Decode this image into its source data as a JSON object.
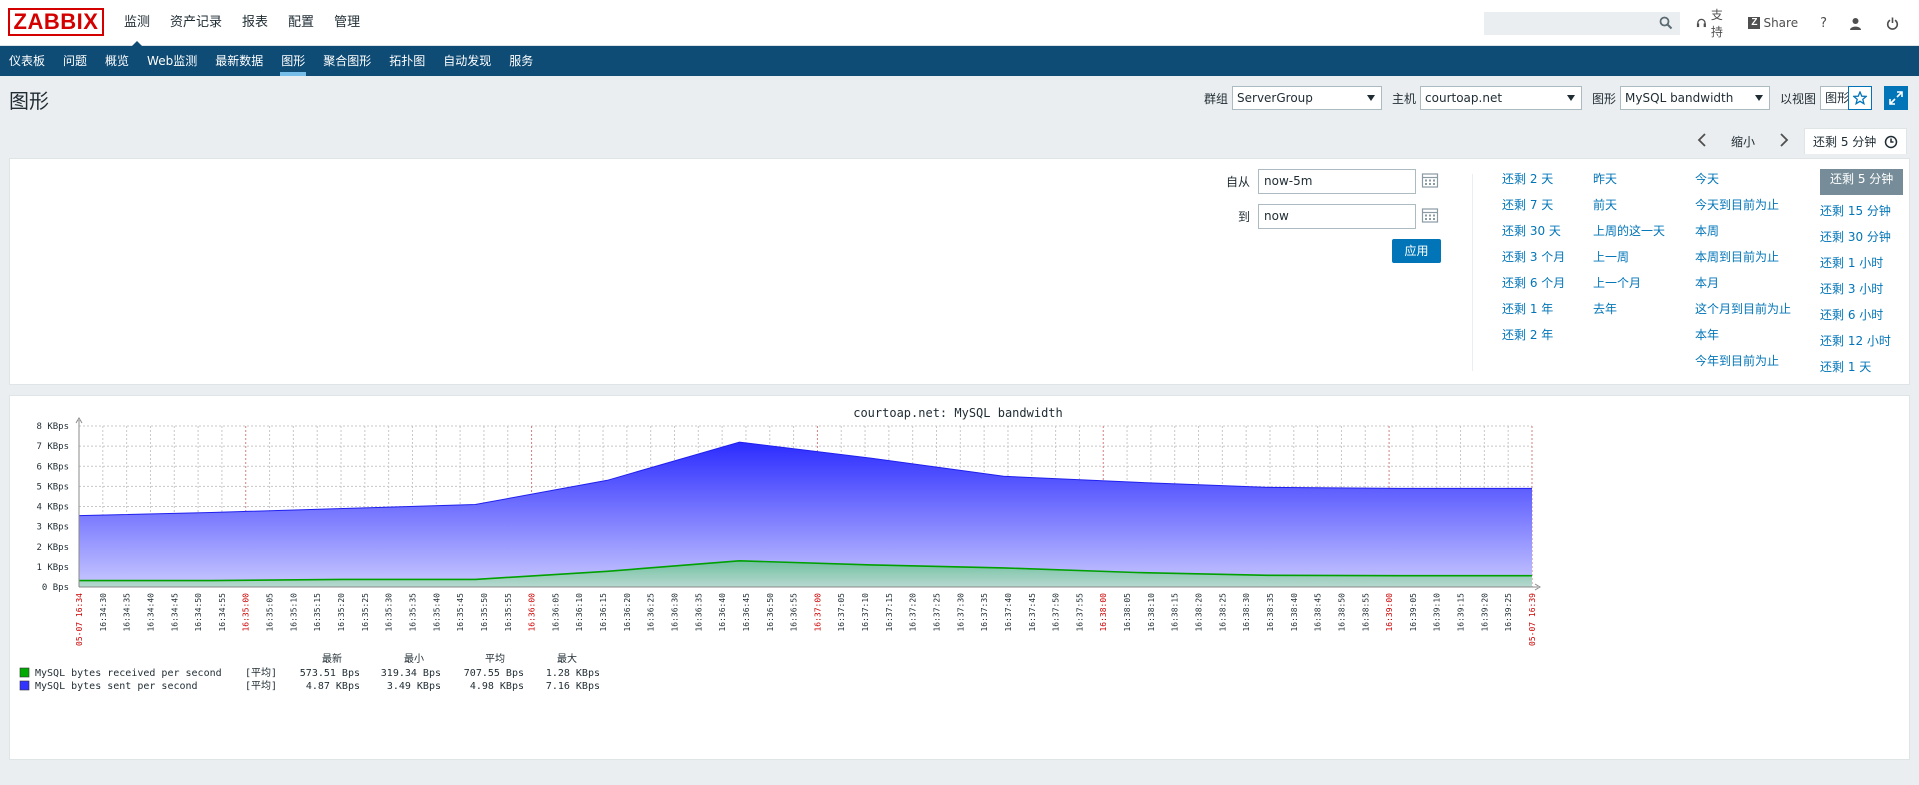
{
  "brand": "ZABBIX",
  "top_menu": [
    "监测",
    "资产记录",
    "报表",
    "配置",
    "管理"
  ],
  "top_tools": {
    "support": "支持",
    "share": "Share",
    "help": "?"
  },
  "sub_menu": [
    "仪表板",
    "问题",
    "概览",
    "Web监测",
    "最新数据",
    "图形",
    "聚合图形",
    "拓扑图",
    "自动发现",
    "服务"
  ],
  "page": {
    "title": "图形"
  },
  "filters": {
    "group_label": "群组",
    "group_value": "ServerGroup",
    "host_label": "主机",
    "host_value": "courtoap.net",
    "graph_label": "图形",
    "graph_value": "MySQL bandwidth",
    "view_label": "以视图",
    "view_value": "图形"
  },
  "timebar": {
    "zoom_out": "缩小",
    "current": "还剩 5 分钟"
  },
  "time_filter": {
    "from_label": "自从",
    "from_value": "now-5m",
    "to_label": "到",
    "to_value": "now",
    "apply": "应用",
    "col1": [
      "还剩 2 天",
      "还剩 7 天",
      "还剩 30 天",
      "还剩 3 个月",
      "还剩 6 个月",
      "还剩 1 年",
      "还剩 2 年"
    ],
    "col2": [
      "昨天",
      "前天",
      "上周的这一天",
      "上一周",
      "上一个月",
      "去年"
    ],
    "col3": [
      "今天",
      "今天到目前为止",
      "本周",
      "本周到目前为止",
      "本月",
      "这个月到目前为止",
      "本年",
      "今年到目前为止"
    ],
    "col4": [
      "还剩 5 分钟",
      "还剩 15 分钟",
      "还剩 30 分钟",
      "还剩 1 小时",
      "还剩 3 小时",
      "还剩 6 小时",
      "还剩 12 小时",
      "还剩 1 天"
    ]
  },
  "colors": {
    "sent": "#3333ff",
    "received": "#00aa00",
    "nav": "#0e4b75",
    "link": "#0275b8"
  },
  "chart_data": {
    "type": "area",
    "title": "courtoap.net: MySQL bandwidth",
    "y_unit": "KBps",
    "ylim": [
      0,
      8
    ],
    "y_ticks": [
      "0 Bps",
      "1 KBps",
      "2 KBps",
      "3 KBps",
      "4 KBps",
      "5 KBps",
      "6 KBps",
      "7 KBps",
      "8 KBps"
    ],
    "x_ticks": [
      "05-07 16:34",
      "16:34:30",
      "16:34:35",
      "16:34:40",
      "16:34:45",
      "16:34:50",
      "16:34:55",
      "16:35:00",
      "16:35:05",
      "16:35:10",
      "16:35:15",
      "16:35:20",
      "16:35:25",
      "16:35:30",
      "16:35:35",
      "16:35:40",
      "16:35:45",
      "16:35:50",
      "16:35:55",
      "16:36:00",
      "16:36:05",
      "16:36:10",
      "16:36:15",
      "16:36:20",
      "16:36:25",
      "16:36:30",
      "16:36:35",
      "16:36:40",
      "16:36:45",
      "16:36:50",
      "16:36:55",
      "16:37:00",
      "16:37:05",
      "16:37:10",
      "16:37:15",
      "16:37:20",
      "16:37:25",
      "16:37:30",
      "16:37:35",
      "16:37:40",
      "16:37:45",
      "16:37:50",
      "16:37:55",
      "16:38:00",
      "16:38:05",
      "16:38:10",
      "16:38:15",
      "16:38:20",
      "16:38:25",
      "16:38:30",
      "16:38:35",
      "16:38:40",
      "16:38:45",
      "16:38:50",
      "16:38:55",
      "16:39:00",
      "16:39:05",
      "16:39:10",
      "16:39:15",
      "16:39:20",
      "16:39:25",
      "05-07 16:39"
    ],
    "x_ticks_red": [
      "05-07 16:34",
      "16:35:00",
      "16:36:00",
      "16:37:00",
      "16:38:00",
      "16:39:00",
      "05-07 16:39"
    ],
    "x": [
      0,
      27,
      54,
      81,
      108,
      135,
      162,
      189,
      216,
      243,
      270,
      297
    ],
    "series": [
      {
        "name": "MySQL bytes sent per second",
        "values": [
          3.55,
          3.7,
          3.9,
          4.1,
          5.3,
          7.2,
          6.4,
          5.5,
          5.2,
          4.95,
          4.9,
          4.9
        ]
      },
      {
        "name": "MySQL bytes received per second",
        "values": [
          0.32,
          0.32,
          0.38,
          0.38,
          0.78,
          1.3,
          1.1,
          0.95,
          0.72,
          0.58,
          0.56,
          0.56
        ]
      }
    ],
    "legend": {
      "headers": [
        "最新",
        "最小",
        "平均",
        "最大"
      ],
      "rows": [
        {
          "name": "MySQL bytes received per second",
          "func": "[平均]",
          "last": "573.51 Bps",
          "min": "319.34 Bps",
          "avg": "707.55 Bps",
          "max": "1.28 KBps"
        },
        {
          "name": "MySQL bytes sent per second",
          "func": "[平均]",
          "last": "4.87 KBps",
          "min": "3.49 KBps",
          "avg": "4.98 KBps",
          "max": "7.16 KBps"
        }
      ]
    }
  }
}
